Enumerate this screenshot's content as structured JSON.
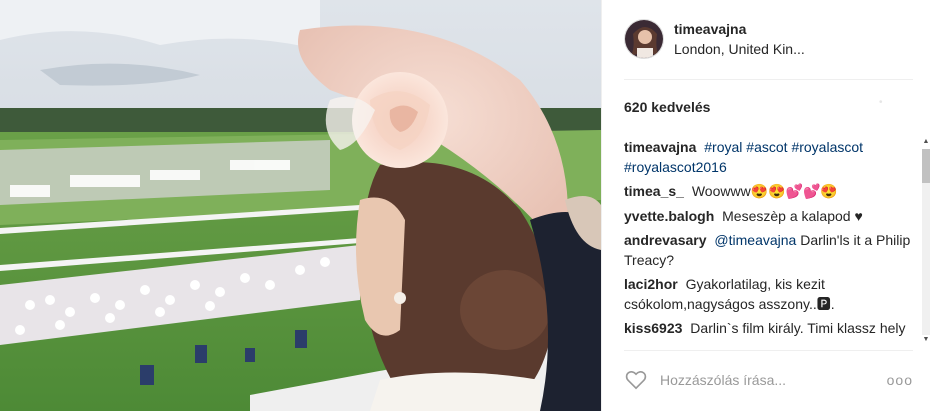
{
  "post": {
    "username": "timeavajna",
    "location": "London, United Kin...",
    "likes": "620 kedvelés",
    "caption": {
      "user": "timeavajna",
      "tags": [
        "#royal",
        "#ascot",
        "#royalascot",
        "#royalascot2016"
      ]
    },
    "comments": [
      {
        "user": "timea_s_",
        "text": "Woowww😍😍💕💕😍"
      },
      {
        "user": "yvette.balogh",
        "text": "Meseszèp a kalapod ♥"
      },
      {
        "user": "andrevasary",
        "mention": "@timeavajna",
        "text": "Darlin'ls it a Philip Treacy?"
      },
      {
        "user": "laci2hor",
        "text": "Gyakorlatilag, kis kezit csókolom,nagyságos asszony..🅿."
      },
      {
        "user": "kiss6923",
        "text": "Darlin`s film király. Timi klassz hely vagy"
      }
    ],
    "comment_placeholder": "Hozzászólás írása...",
    "more_label": "ooo"
  },
  "icons": {
    "heart": "heart-outline-icon",
    "more": "more-options-icon",
    "scroll_up": "scroll-up-arrow-icon",
    "scroll_down": "scroll-down-arrow-icon"
  },
  "colors": {
    "link": "#003569",
    "text": "#262626",
    "placeholder": "#999999"
  }
}
